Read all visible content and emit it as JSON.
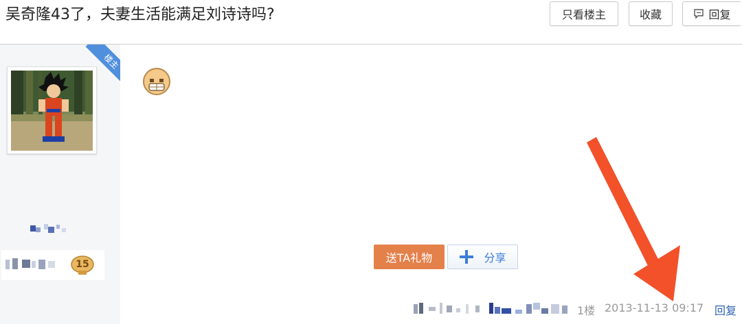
{
  "header": {
    "title": "吴奇隆43了，夫妻生活能满足刘诗诗吗?",
    "only_op_label": "只看楼主",
    "favorite_label": "收藏",
    "reply_label": "回复"
  },
  "author": {
    "op_badge": "楼主",
    "level": "15"
  },
  "post": {
    "gift_button": "送TA礼物",
    "share_button": "分享",
    "floor": "1楼",
    "timestamp": "2013-11-13 09:17",
    "reply_link": "回复"
  },
  "colors": {
    "gift": "#e4804a",
    "share_blue": "#3b7dd8",
    "badge_blue": "#4f8fdc",
    "arrow": "#f2512a",
    "link": "#2d64b3"
  },
  "icons": [
    "comment-icon",
    "plus-icon",
    "emoji-icon",
    "level-badge-icon",
    "annotation-arrow"
  ]
}
